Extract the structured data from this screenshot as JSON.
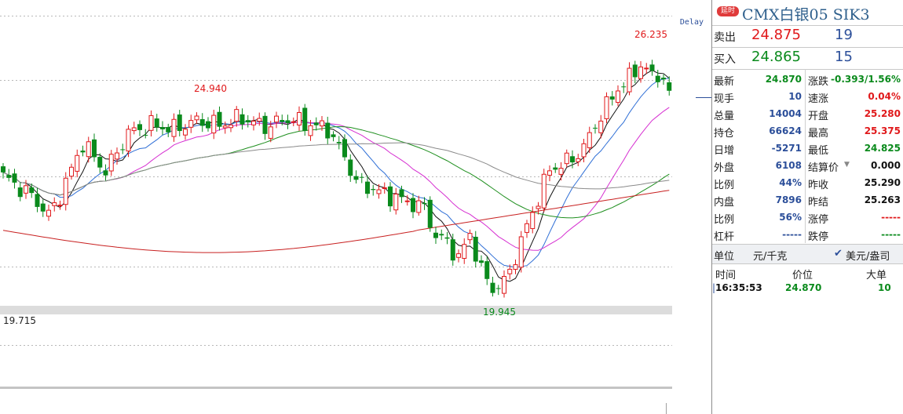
{
  "chart": {
    "delay_label": "Delay",
    "high_marker": "26.235",
    "peak_marker": "24.940",
    "low_marker": "19.945",
    "left_marker": "19.715",
    "colors": {
      "up": "#e0191b",
      "down": "#0a8a1c",
      "ma5": "#111111",
      "ma10": "#2f6fd6",
      "ma20": "#d62fd1",
      "ma40": "#1f8f1f",
      "ma60": "#8a8a8a",
      "ma120": "#c82020"
    }
  },
  "quote": {
    "delay_badge": "延时",
    "title": "CMX白银05  SIK3",
    "ask_label": "卖出",
    "ask_price": "24.875",
    "ask_volume": "19",
    "bid_label": "买入",
    "bid_price": "24.865",
    "bid_volume": "15",
    "left_stats": [
      {
        "label": "最新",
        "value": "24.870",
        "color": "#0a8a1c"
      },
      {
        "label": "现手",
        "value": "10",
        "color": "#2c4f9a"
      },
      {
        "label": "总量",
        "value": "14004",
        "color": "#2c4f9a"
      },
      {
        "label": "持仓",
        "value": "66624",
        "color": "#2c4f9a"
      },
      {
        "label": "日增",
        "value": "-5271",
        "color": "#2c4f9a"
      },
      {
        "label": "外盘",
        "value": "6108",
        "color": "#2c4f9a"
      },
      {
        "label": "比例",
        "value": "44%",
        "color": "#2c4f9a"
      },
      {
        "label": "内盘",
        "value": "7896",
        "color": "#2c4f9a"
      },
      {
        "label": "比例",
        "value": "56%",
        "color": "#2c4f9a"
      },
      {
        "label": "杠杆",
        "value": "-----",
        "color": "#2c4f9a"
      }
    ],
    "right_stats": [
      {
        "label": "涨跌",
        "value": "-0.393/1.56%",
        "color": "#0a8a1c"
      },
      {
        "label": "速涨",
        "value": "0.04%",
        "color": "#e0191b"
      },
      {
        "label": "开盘",
        "value": "25.280",
        "color": "#e0191b"
      },
      {
        "label": "最高",
        "value": "25.375",
        "color": "#e0191b"
      },
      {
        "label": "最低",
        "value": "24.825",
        "color": "#0a8a1c"
      },
      {
        "label": "结算价",
        "value": "0.000",
        "color": "#111111"
      },
      {
        "label": "昨收",
        "value": "25.290",
        "color": "#111111"
      },
      {
        "label": "昨结",
        "value": "25.263",
        "color": "#111111"
      },
      {
        "label": "涨停",
        "value": "-----",
        "color": "#e0191b"
      },
      {
        "label": "跌停",
        "value": "-----",
        "color": "#0a8a1c"
      }
    ],
    "unit_label": "单位",
    "unit_value": "元/千克",
    "currency_check": "✔",
    "currency_value": "美元/盎司",
    "trades_headers": {
      "time": "时间",
      "price": "价位",
      "volume": "大单"
    },
    "trades": [
      {
        "time": "16:35:53",
        "price": "24.870",
        "volume": "10"
      }
    ]
  }
}
